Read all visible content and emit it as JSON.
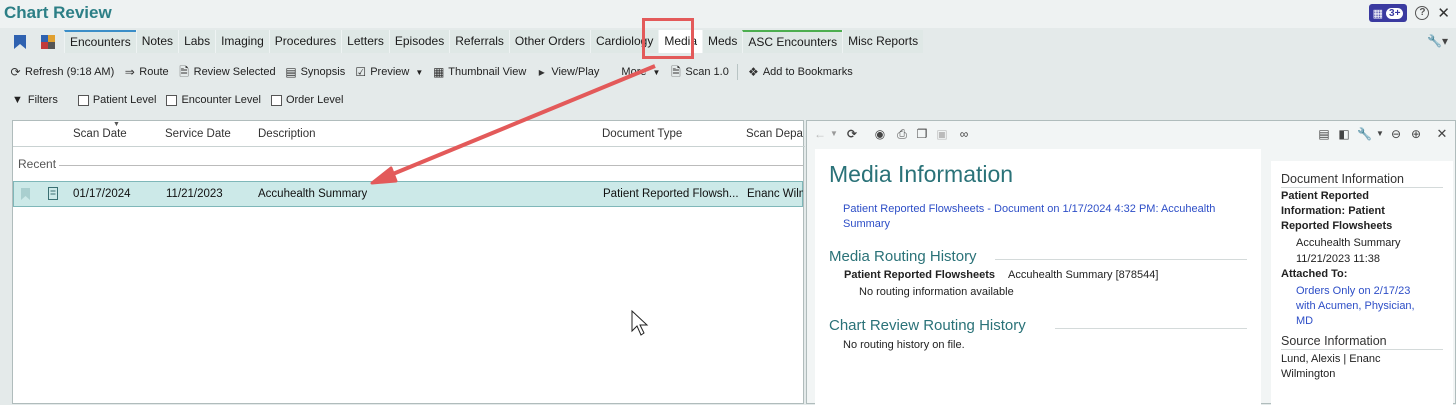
{
  "app": {
    "title": "Chart Review",
    "badge_count": "3+"
  },
  "tabs": [
    "Encounters",
    "Notes",
    "Labs",
    "Imaging",
    "Procedures",
    "Letters",
    "Episodes",
    "Referrals",
    "Other Orders",
    "Cardiology",
    "Media",
    "Meds",
    "ASC Encounters",
    "Misc Reports"
  ],
  "toolbar": {
    "refresh": "Refresh (9:18 AM)",
    "route": "Route",
    "review_selected": "Review Selected",
    "synopsis": "Synopsis",
    "preview": "Preview",
    "thumbnail_view": "Thumbnail View",
    "view_play": "View/Play",
    "more": "More",
    "scan": "Scan 1.0",
    "add_to_bookmarks": "Add to Bookmarks"
  },
  "filters": {
    "label": "Filters",
    "patient_level": "Patient Level",
    "encounter_level": "Encounter Level",
    "order_level": "Order Level"
  },
  "list": {
    "columns": [
      "Scan Date",
      "Service Date",
      "Description",
      "Document Type",
      "Scan Depa"
    ],
    "group": "Recent",
    "rows": [
      {
        "scan_date": "01/17/2024",
        "service_date": "11/21/2023",
        "description": "Accuhealth Summary",
        "document_type": "Patient Reported Flowsh...",
        "scan_dept": "Enanc Wilm"
      }
    ]
  },
  "media_info": {
    "title": "Media Information",
    "link_line1": "Patient Reported Flowsheets - Document on 1/17/2024 4:32 PM: Accuhealth",
    "link_line2": "Summary",
    "routing_history_title": "Media Routing History",
    "routing_label": "Patient Reported Flowsheets",
    "routing_value": "Accuhealth Summary [878544]",
    "routing_none": "No routing information available",
    "chart_routing_title": "Chart Review Routing History",
    "chart_routing_none": "No routing history on file."
  },
  "doc_info": {
    "title": "Document Information",
    "type_line1": "Patient Reported",
    "type_line2": "Information: Patient",
    "type_line3": "Reported Flowsheets",
    "desc": "Accuhealth Summary",
    "datetime": "11/21/2023 11:38",
    "attached_label": "Attached To:",
    "attached_line1": "Orders Only on 2/17/23",
    "attached_line2": "with Acumen, Physician,",
    "attached_line3": "MD",
    "source_title": "Source Information",
    "source_line1": "Lund, Alexis | Enanc",
    "source_line2": "Wilmington"
  },
  "colors": {
    "accent": "#2a7278",
    "link": "#2d4ec7",
    "highlight": "#e35a5a",
    "row_selected": "#cce9e8"
  }
}
